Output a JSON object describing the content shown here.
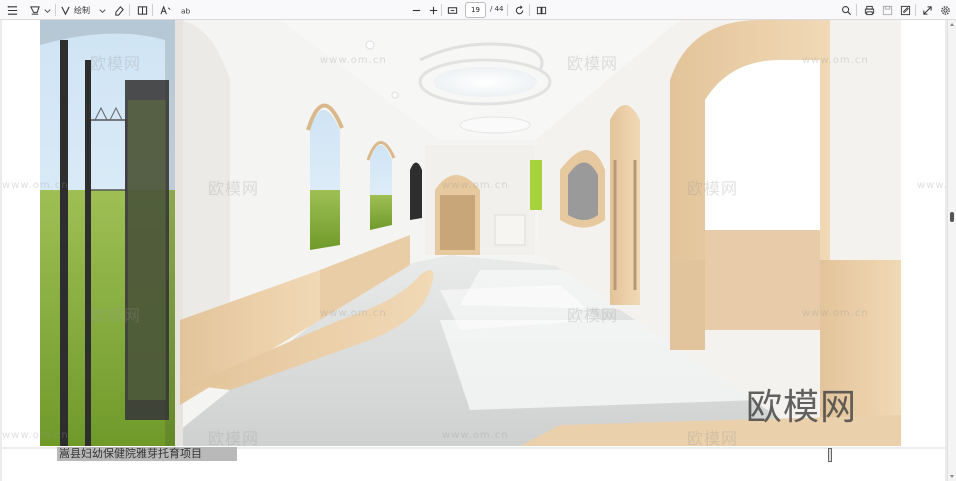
{
  "toolbar": {
    "draw_label": "绘制",
    "page_current": "19",
    "page_total": "/ 44"
  },
  "watermarks": {
    "brand": "欧模网",
    "url": "www.om.cn",
    "logo": "欧模网"
  },
  "document": {
    "selected_text": "嵩县妇幼保健院雅芽托育项目"
  },
  "colors": {
    "toolbar_bg": "#f9f9fb",
    "viewer_bg": "#ececec",
    "selection": "#b9b9b9"
  }
}
